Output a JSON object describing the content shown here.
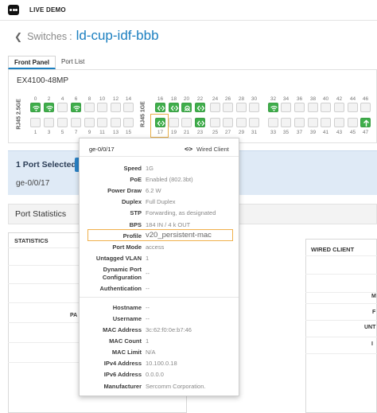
{
  "app": {
    "title": "LIVE DEMO"
  },
  "breadcrumb": {
    "section": "Switches",
    "name": "ld-cup-idf-bbb"
  },
  "tabs": [
    {
      "label": "Front Panel"
    },
    {
      "label": "Port List"
    }
  ],
  "switch": {
    "model": "EX4100-48MP"
  },
  "port_groups": [
    {
      "label": "RJ45 2.5GE"
    },
    {
      "label": "RJ45 1GE"
    }
  ],
  "ports": {
    "top_numbers": [
      "0",
      "2",
      "4",
      "6",
      "8",
      "10",
      "12",
      "14",
      "16",
      "18",
      "20",
      "22",
      "24",
      "26",
      "28",
      "30",
      "32",
      "34",
      "36",
      "38",
      "40",
      "42",
      "44",
      "46"
    ],
    "bottom_numbers": [
      "1",
      "3",
      "5",
      "7",
      "9",
      "11",
      "13",
      "15",
      "17",
      "19",
      "21",
      "23",
      "25",
      "27",
      "29",
      "31",
      "33",
      "35",
      "37",
      "39",
      "41",
      "43",
      "45",
      "47"
    ],
    "top_status": [
      "wifi",
      "wifi",
      "empty",
      "wifi",
      "empty",
      "empty",
      "empty",
      "empty",
      "client",
      "client",
      "ap",
      "client",
      "empty",
      "empty",
      "empty",
      "empty",
      "wifi",
      "empty",
      "empty",
      "empty",
      "empty",
      "empty",
      "empty",
      "empty"
    ],
    "bottom_status": [
      "empty",
      "empty",
      "empty",
      "empty",
      "empty",
      "empty",
      "empty",
      "empty",
      "client",
      "empty",
      "empty",
      "client",
      "empty",
      "empty",
      "empty",
      "empty",
      "empty",
      "empty",
      "empty",
      "empty",
      "empty",
      "empty",
      "empty",
      "uplink"
    ]
  },
  "selection": {
    "count_label": "1 Port Selected",
    "port": "ge-0/0/17"
  },
  "port_statistics": {
    "title": "Port Statistics"
  },
  "statistics_card": {
    "title": "STATISTICS",
    "cut_label": "PA"
  },
  "wired_client_card": {
    "title": "WIRED CLIENT",
    "cut_labels": [
      "M",
      "F",
      "UNT",
      "I"
    ]
  },
  "popup": {
    "port": "ge-0/0/17",
    "type_icon": "<·>",
    "type_label": "Wired Client",
    "rows": [
      {
        "key": "Speed",
        "value": "1G"
      },
      {
        "key": "PoE",
        "value": "Enabled (802.3bt)"
      },
      {
        "key": "Power Draw",
        "value": "6.2 W"
      },
      {
        "key": "Duplex",
        "value": "Full Duplex"
      },
      {
        "key": "STP",
        "value": "Forwarding, as designated"
      },
      {
        "key": "BPS",
        "value": "184 IN / 4 k OUT"
      }
    ],
    "profile": {
      "key": "Profile",
      "value": "v20_persistent-mac"
    },
    "rows2": [
      {
        "key": "Port Mode",
        "value": "access"
      },
      {
        "key": "Untagged VLAN",
        "value": "1"
      },
      {
        "key": "Dynamic Port\nConfiguration",
        "value": "--"
      },
      {
        "key": "Authentication",
        "value": "--"
      }
    ],
    "rows3": [
      {
        "key": "Hostname",
        "value": "--"
      },
      {
        "key": "Username",
        "value": "--"
      },
      {
        "key": "MAC Address",
        "value": "3c:62:f0:0e:b7:46"
      },
      {
        "key": "MAC Count",
        "value": "1"
      },
      {
        "key": "MAC Limit",
        "value": "N/A"
      },
      {
        "key": "IPv4 Address",
        "value": "10.100.0.18"
      },
      {
        "key": "IPv6 Address",
        "value": "0.0.0.0"
      },
      {
        "key": "Manufacturer",
        "value": "Sercomm Corporation."
      }
    ]
  },
  "colors": {
    "accent": "#1b7fc0",
    "port_up": "#3fae4b",
    "highlight": "#f0b04c",
    "selection_band": "#dfeaf6"
  }
}
